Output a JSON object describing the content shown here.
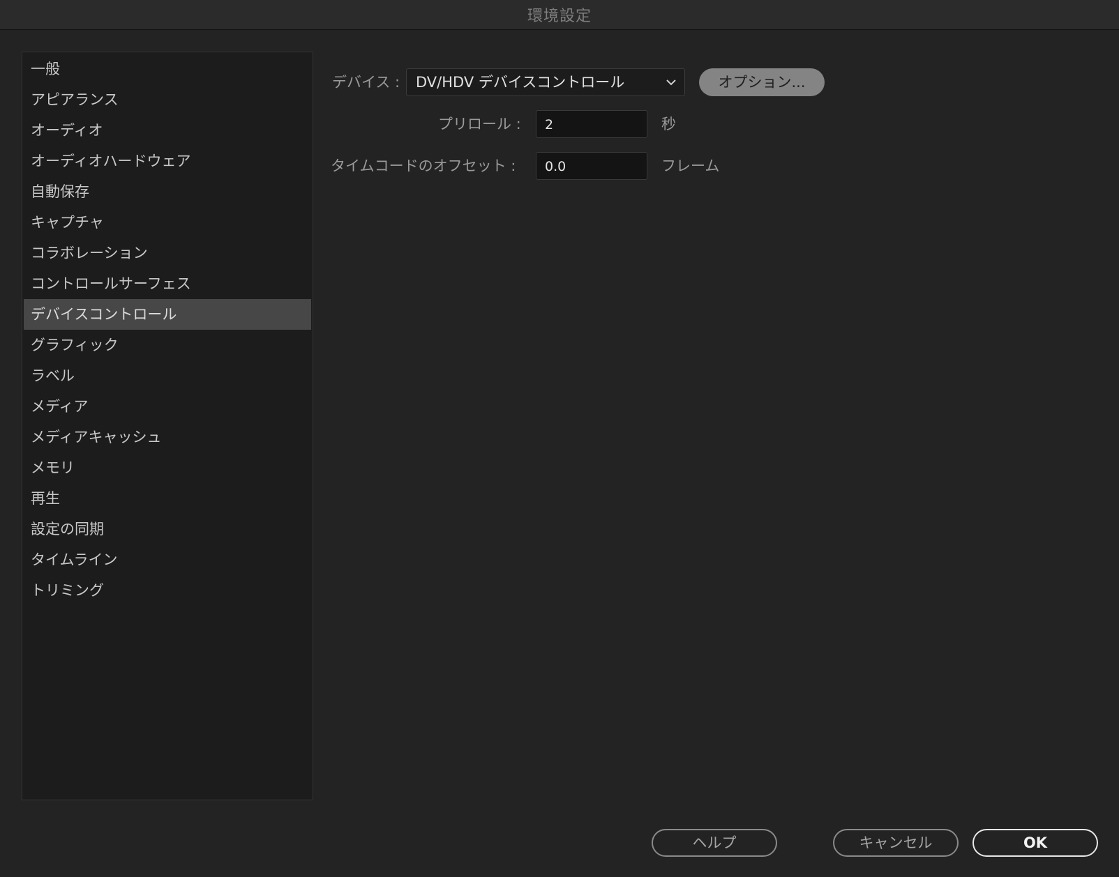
{
  "window": {
    "title": "環境設定"
  },
  "sidebar": {
    "selected_index": 8,
    "items": [
      {
        "label": "一般"
      },
      {
        "label": "アピアランス"
      },
      {
        "label": "オーディオ"
      },
      {
        "label": "オーディオハードウェア"
      },
      {
        "label": "自動保存"
      },
      {
        "label": "キャプチャ"
      },
      {
        "label": "コラボレーション"
      },
      {
        "label": "コントロールサーフェス"
      },
      {
        "label": "デバイスコントロール"
      },
      {
        "label": "グラフィック"
      },
      {
        "label": "ラベル"
      },
      {
        "label": "メディア"
      },
      {
        "label": "メディアキャッシュ"
      },
      {
        "label": "メモリ"
      },
      {
        "label": "再生"
      },
      {
        "label": "設定の同期"
      },
      {
        "label": "タイムライン"
      },
      {
        "label": "トリミング"
      }
    ]
  },
  "device_control": {
    "device_label": "デバイス :",
    "device_value": "DV/HDV デバイスコントロール",
    "device_dropdown_icon": "chevron-down-icon",
    "options_button": "オプション...",
    "preroll_label": "プリロール :",
    "preroll_value": "2",
    "preroll_unit": "秒",
    "timecode_offset_label": "タイムコードのオフセット :",
    "timecode_offset_value": "0.0",
    "timecode_offset_unit": "フレーム"
  },
  "footer": {
    "help_button": "ヘルプ",
    "cancel_button": "キャンセル",
    "ok_button": "OK"
  },
  "colors": {
    "background": "#232323",
    "sidebar_background": "#1c1c1c",
    "selected_item": "#474747",
    "options_button": "#848484"
  }
}
